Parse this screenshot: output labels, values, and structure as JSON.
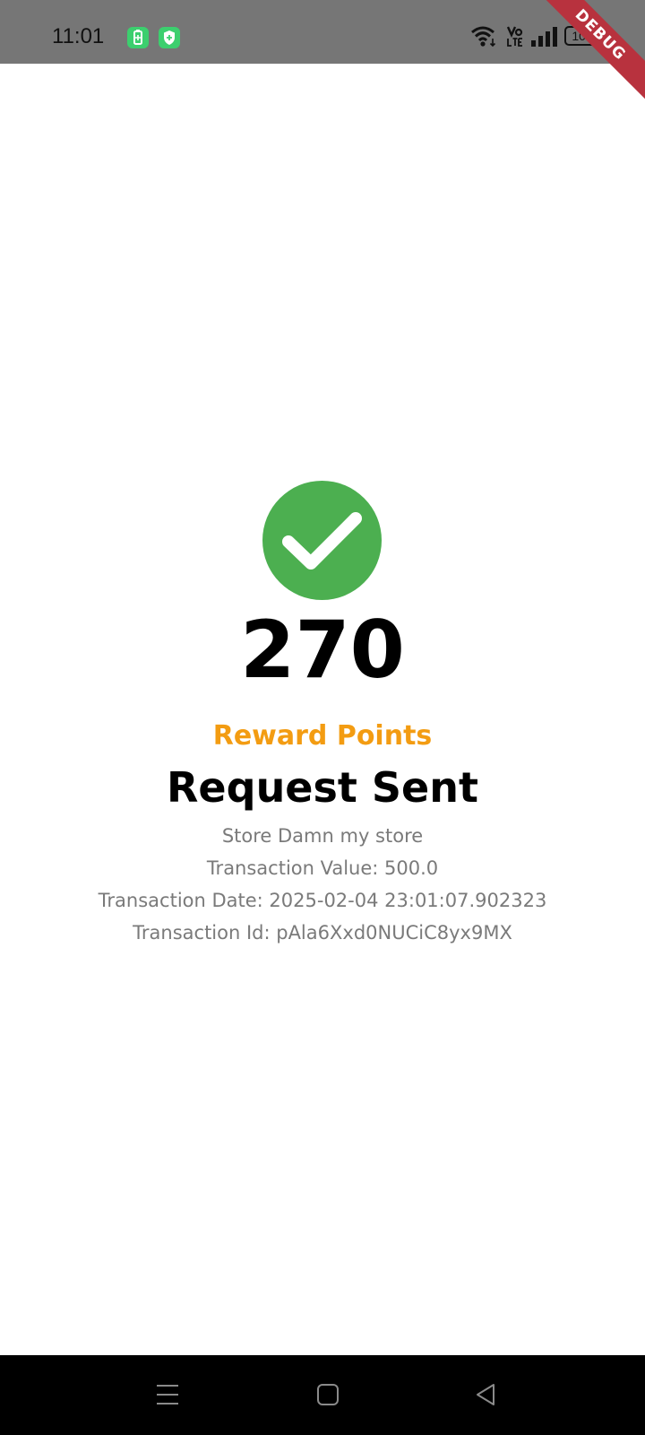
{
  "status_bar": {
    "time": "11:01",
    "battery": "100",
    "icons": [
      "battery-saver-icon",
      "shield-icon",
      "wifi-icon",
      "volte-icon",
      "signal-icon",
      "battery-icon"
    ]
  },
  "debug_banner": "DEBUG",
  "result": {
    "icon": "check-circle-icon",
    "points": "270",
    "points_label": "Reward Points",
    "title": "Request Sent",
    "store": "Store Damn my store",
    "transaction_value": "Transaction Value: 500.0",
    "transaction_date": "Transaction Date: 2025-02-04 23:01:07.902323",
    "transaction_id": "Transaction Id: pAla6Xxd0NUCiC8yx9MX"
  },
  "colors": {
    "status_bar": "#767676",
    "success_green": "#4caf50",
    "accent_orange": "#f39c12",
    "detail_gray": "#7a7a7a",
    "debug_red": "#b8323e"
  },
  "nav_bar": {
    "buttons": [
      "menu-icon",
      "home-icon",
      "back-icon"
    ]
  }
}
